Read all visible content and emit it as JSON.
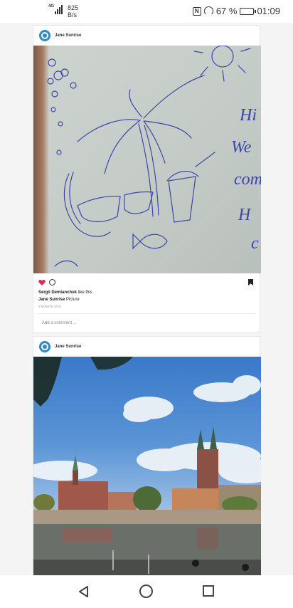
{
  "status_bar": {
    "network": "4G",
    "speed_value": "825",
    "speed_unit": "B/s",
    "battery": "67 %",
    "battery_level": 0.67,
    "time": "01:09"
  },
  "posts": [
    {
      "user": "Jane Sunrise",
      "likes_name": "Sergii Demianchuk",
      "likes_suffix": " like this",
      "caption_user": "Jane Sunrise",
      "caption_text": " Picture",
      "time": "1 MINUTE AGO",
      "comment_placeholder": "Add a comment ...",
      "sketch_text": [
        "Hi",
        "We",
        "com",
        "H",
        "c"
      ]
    },
    {
      "user": "Jane Sunrise"
    }
  ],
  "colors": {
    "heart": "#e0245e",
    "avatar": "#2f89c8"
  },
  "nav": {
    "back": "back-icon",
    "home": "home-icon",
    "recent": "recent-apps-icon"
  }
}
